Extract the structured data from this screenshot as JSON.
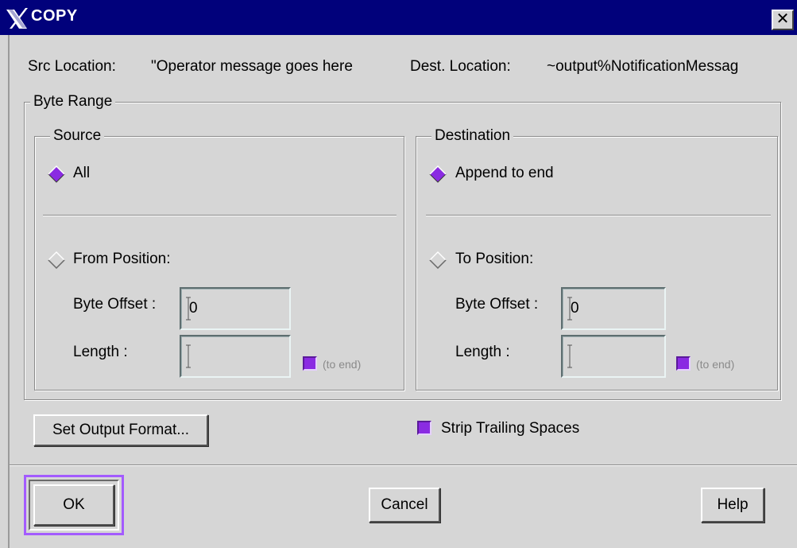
{
  "window": {
    "title": "COPY",
    "close_label": "✕"
  },
  "locations": {
    "src_label": "Src Location:",
    "src_value": "\"Operator message goes here",
    "dest_label": "Dest. Location:",
    "dest_value": "~output%NotificationMessag"
  },
  "byte_range": {
    "title": "Byte Range",
    "source": {
      "title": "Source",
      "all_label": "All",
      "all_selected": true,
      "from_label": "From Position:",
      "from_selected": false,
      "offset_label": "Byte Offset :",
      "offset_value": "0",
      "length_label": "Length :",
      "length_value": "",
      "to_end_label": "(to end)",
      "to_end_checked": true
    },
    "destination": {
      "title": "Destination",
      "append_label": "Append to end",
      "append_selected": true,
      "to_label": "To Position:",
      "to_selected": false,
      "offset_label": "Byte Offset :",
      "offset_value": "0",
      "length_label": "Length :",
      "length_value": "",
      "to_end_label": "(to end)",
      "to_end_checked": true
    }
  },
  "options": {
    "set_output_format_label": "Set Output Format...",
    "strip_trailing_label": "Strip Trailing Spaces",
    "strip_trailing_checked": true
  },
  "buttons": {
    "ok": "OK",
    "cancel": "Cancel",
    "help": "Help"
  },
  "colors": {
    "titlebar": "#01017b",
    "accent": "#8a2be2",
    "focus": "#a35bff",
    "background": "#d6d6d6"
  }
}
